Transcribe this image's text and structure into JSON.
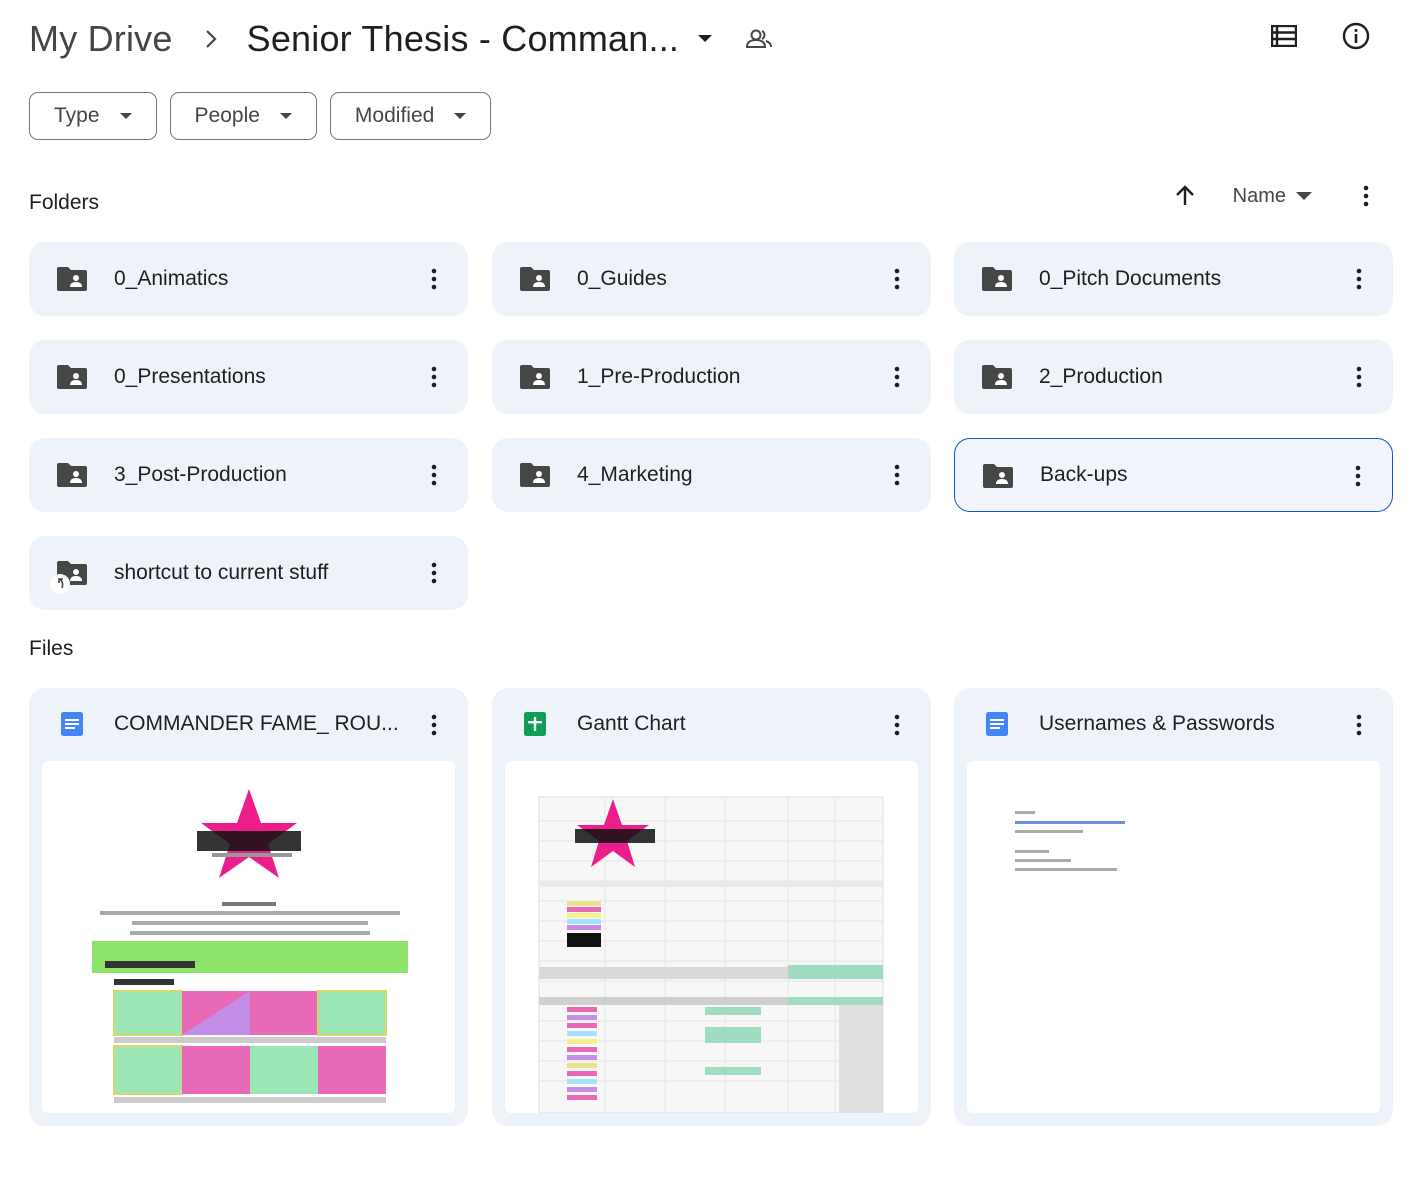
{
  "header": {
    "root": "My Drive",
    "current_folder": "Senior Thesis - Comman..."
  },
  "filters": [
    "Type",
    "People",
    "Modified"
  ],
  "sections": {
    "folders_label": "Folders",
    "files_label": "Files"
  },
  "sort": {
    "label": "Name"
  },
  "folders": [
    {
      "name": "0_Animatics"
    },
    {
      "name": "0_Guides"
    },
    {
      "name": "0_Pitch Documents"
    },
    {
      "name": "0_Presentations"
    },
    {
      "name": "1_Pre-Production"
    },
    {
      "name": "2_Production"
    },
    {
      "name": "3_Post-Production"
    },
    {
      "name": "4_Marketing"
    },
    {
      "name": "Back-ups",
      "selected": true
    },
    {
      "name": "shortcut to current stuff",
      "shortcut": true
    }
  ],
  "files": [
    {
      "name": "COMMANDER FAME_ ROU...",
      "type": "doc",
      "icon": "docs-icon"
    },
    {
      "name": "Gantt Chart",
      "type": "sheet",
      "icon": "sheets-icon"
    },
    {
      "name": "Usernames & Passwords",
      "type": "doc",
      "icon": "docs-icon"
    }
  ],
  "colors": {
    "card_bg": "#eef2f9",
    "selected_border": "#0b57d0",
    "docs_blue": "#4285f4",
    "sheets_green": "#0f9d58",
    "star_pink": "#ec1e8c"
  }
}
